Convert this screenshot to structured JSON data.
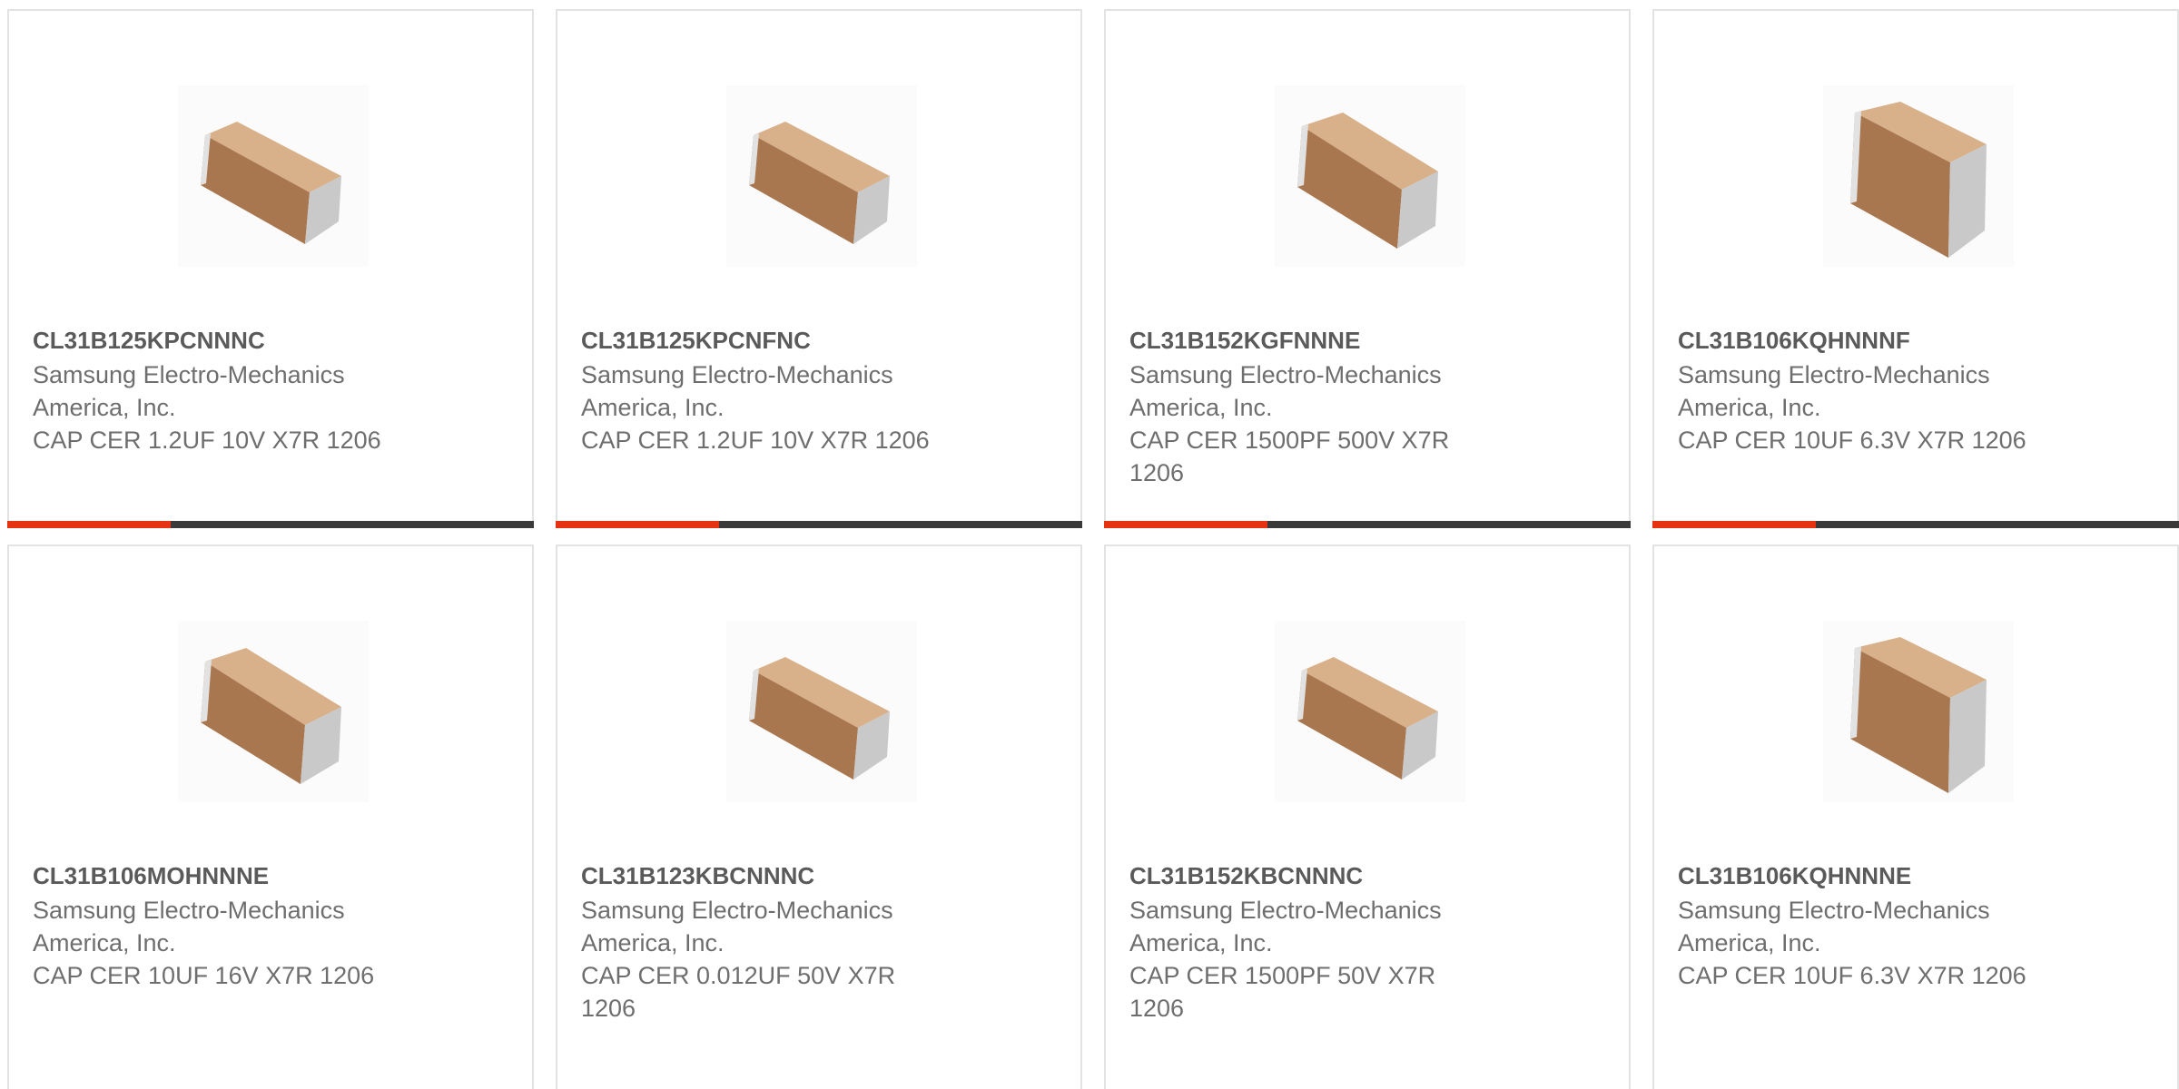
{
  "colors": {
    "card_border": "#e3e3e3",
    "part_number_text": "#5a5a5a",
    "body_text": "#6e6e6e",
    "progress_track": "#3a3a3a",
    "progress_fill": "#e63312",
    "capacitor_body": "#b88a62",
    "capacitor_terminal": "#cfcfcf"
  },
  "products": [
    {
      "part_number": "CL31B125KPCNNNC",
      "manufacturer": "Samsung Electro-Mechanics America, Inc.",
      "description": "CAP CER 1.2UF 10V X7R 1206",
      "image_icon": "ceramic-capacitor-chip-icon",
      "progress_fraction": 0.31
    },
    {
      "part_number": "CL31B125KPCNFNC",
      "manufacturer": "Samsung Electro-Mechanics America, Inc.",
      "description": "CAP CER 1.2UF 10V X7R 1206",
      "image_icon": "ceramic-capacitor-chip-icon",
      "progress_fraction": 0.31
    },
    {
      "part_number": "CL31B152KGFNNNE",
      "manufacturer": "Samsung Electro-Mechanics America, Inc.",
      "description": "CAP CER 1500PF 500V X7R 1206",
      "image_icon": "ceramic-capacitor-chip-icon",
      "progress_fraction": 0.31
    },
    {
      "part_number": "CL31B106KQHNNNF",
      "manufacturer": "Samsung Electro-Mechanics America, Inc.",
      "description": "CAP CER 10UF 6.3V X7R 1206",
      "image_icon": "ceramic-capacitor-chip-icon",
      "progress_fraction": 0.31
    },
    {
      "part_number": "CL31B106MOHNNNE",
      "manufacturer": "Samsung Electro-Mechanics America, Inc.",
      "description": "CAP CER 10UF 16V X7R 1206",
      "image_icon": "ceramic-capacitor-chip-icon"
    },
    {
      "part_number": "CL31B123KBCNNNC",
      "manufacturer": "Samsung Electro-Mechanics America, Inc.",
      "description": "CAP CER 0.012UF 50V X7R 1206",
      "image_icon": "ceramic-capacitor-chip-icon"
    },
    {
      "part_number": "CL31B152KBCNNNC",
      "manufacturer": "Samsung Electro-Mechanics America, Inc.",
      "description": "CAP CER 1500PF 50V X7R 1206",
      "image_icon": "ceramic-capacitor-chip-icon"
    },
    {
      "part_number": "CL31B106KQHNNNE",
      "manufacturer": "Samsung Electro-Mechanics America, Inc.",
      "description": "CAP CER 10UF 6.3V X7R 1206",
      "image_icon": "ceramic-capacitor-chip-icon"
    }
  ]
}
